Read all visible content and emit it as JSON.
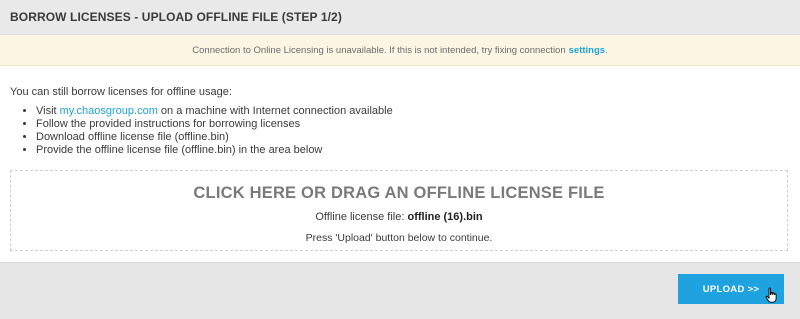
{
  "header": {
    "title": "BORROW LICENSES - UPLOAD OFFLINE FILE (STEP 1/2)"
  },
  "notice": {
    "text": "Connection to Online Licensing is unavailable. If this is not intended, try fixing connection",
    "link_label": "settings",
    "suffix": "."
  },
  "content": {
    "intro": "You can still borrow licenses for offline usage:",
    "step1_prefix": "Visit ",
    "step1_link": "my.chaosgroup.com",
    "step1_suffix": " on a machine with Internet connection available",
    "step2": "Follow the provided instructions for borrowing licenses",
    "step3": "Download offline license file (offline.bin)",
    "step4": "Provide the offline license file (offline.bin) in the area below"
  },
  "dropzone": {
    "title": "CLICK HERE OR DRAG AN OFFLINE LICENSE FILE",
    "file_label": "Offline license file: ",
    "file_name": "offline (16).bin",
    "hint": "Press 'Upload' button below to continue."
  },
  "footer": {
    "upload_label": "UPLOAD >>"
  },
  "colors": {
    "accent": "#1ea3e0",
    "notice_bg": "#fbf6e3",
    "header_bg": "#e9e9e9"
  },
  "icons": {
    "cursor": "hand-pointer-icon"
  }
}
